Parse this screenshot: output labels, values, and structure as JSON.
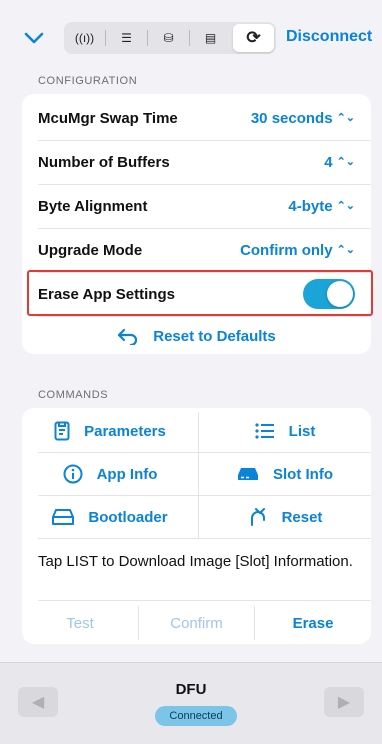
{
  "toolbar": {
    "tabs": [
      {
        "icon": "antenna-icon",
        "glyph": "((ı))"
      },
      {
        "icon": "list-icon",
        "glyph": "☰"
      },
      {
        "icon": "database-icon",
        "glyph": "⛁"
      },
      {
        "icon": "document-icon",
        "glyph": "▤"
      },
      {
        "icon": "sync-icon",
        "glyph": "⟳"
      }
    ],
    "selected_tab": 4,
    "disconnect_label": "Disconnect"
  },
  "configuration": {
    "header": "CONFIGURATION",
    "rows": [
      {
        "label": "McuMgr Swap Time",
        "value": "30 seconds"
      },
      {
        "label": "Number of Buffers",
        "value": "4"
      },
      {
        "label": "Byte Alignment",
        "value": "4-byte"
      },
      {
        "label": "Upgrade Mode",
        "value": "Confirm only"
      }
    ],
    "erase": {
      "label": "Erase App Settings",
      "on": true
    },
    "reset_label": "Reset to Defaults"
  },
  "commands": {
    "header": "COMMANDS",
    "buttons": [
      {
        "label": "Parameters",
        "icon": "parameters-icon"
      },
      {
        "label": "List",
        "icon": "list-icon"
      },
      {
        "label": "App Info",
        "icon": "info-icon"
      },
      {
        "label": "Slot Info",
        "icon": "drive-icon"
      },
      {
        "label": "Bootloader",
        "icon": "bootloader-icon"
      },
      {
        "label": "Reset",
        "icon": "reset-arrow-icon"
      }
    ],
    "hint": "Tap LIST to Download Image [Slot] Information.",
    "actions": [
      {
        "label": "Test",
        "enabled": false
      },
      {
        "label": "Confirm",
        "enabled": false
      },
      {
        "label": "Erase",
        "enabled": true
      }
    ]
  },
  "bottom": {
    "title": "DFU",
    "status": "Connected"
  },
  "colors": {
    "accent": "#0a84d6",
    "toggle_on": "#1ba4d8",
    "highlight": "#e53935"
  }
}
